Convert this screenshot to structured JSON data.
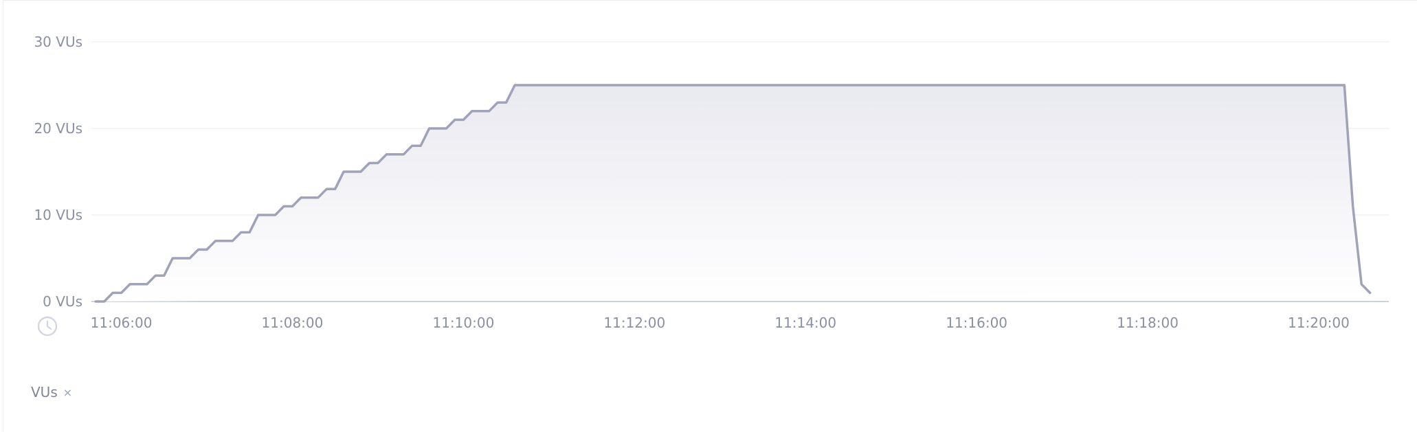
{
  "chart_data": {
    "type": "area",
    "ylim": [
      0,
      30
    ],
    "y_ticks": [
      {
        "value": 0,
        "label": "0 VUs"
      },
      {
        "value": 10,
        "label": "10 VUs"
      },
      {
        "value": 20,
        "label": "20 VUs"
      },
      {
        "value": 30,
        "label": "30 VUs"
      }
    ],
    "x_ticks": [
      "11:06:00",
      "11:08:00",
      "11:10:00",
      "11:12:00",
      "11:14:00",
      "11:16:00",
      "11:18:00",
      "11:20:00"
    ],
    "x_range_minutes": [
      -0.35,
      14.82
    ],
    "grid": true,
    "series": [
      {
        "name": "VUs",
        "color": "#9fa2b8",
        "x_minutes": [
          -0.3,
          -0.2,
          -0.1,
          0.0,
          0.1,
          0.2,
          0.3,
          0.4,
          0.5,
          0.6,
          0.7,
          0.8,
          0.9,
          1.0,
          1.1,
          1.2,
          1.3,
          1.4,
          1.5,
          1.6,
          1.7,
          1.8,
          1.9,
          2.0,
          2.1,
          2.2,
          2.3,
          2.4,
          2.5,
          2.6,
          2.7,
          2.8,
          2.9,
          3.0,
          3.1,
          3.2,
          3.3,
          3.4,
          3.5,
          3.6,
          3.7,
          3.8,
          3.9,
          4.0,
          4.1,
          4.2,
          4.3,
          4.4,
          4.5,
          4.6,
          4.7,
          4.8,
          4.9,
          5.0,
          5.1,
          5.2,
          5.3,
          5.4,
          5.5,
          5.6,
          5.7,
          5.8,
          5.9,
          6.0,
          6.1,
          6.2,
          6.3,
          6.4,
          6.5,
          6.6,
          6.7,
          6.8,
          6.9,
          7.0,
          7.1,
          7.2,
          7.3,
          7.4,
          7.5,
          7.6,
          7.7,
          7.8,
          7.9,
          8.0,
          8.1,
          8.2,
          8.3,
          8.4,
          8.5,
          8.6,
          8.7,
          8.8,
          8.9,
          9.0,
          9.1,
          9.2,
          9.3,
          9.4,
          9.5,
          9.6,
          9.7,
          9.8,
          9.9,
          10.0,
          10.1,
          10.2,
          10.3,
          10.4,
          10.5,
          10.6,
          10.7,
          10.8,
          10.9,
          11.0,
          11.1,
          11.2,
          11.3,
          11.4,
          11.5,
          11.6,
          11.7,
          11.8,
          11.9,
          12.0,
          12.1,
          12.2,
          12.3,
          12.4,
          12.5,
          12.6,
          12.7,
          12.8,
          12.9,
          13.0,
          13.1,
          13.2,
          13.3,
          13.4,
          13.5,
          13.6,
          13.7,
          13.8,
          13.9,
          14.0,
          14.1,
          14.2,
          14.3,
          14.4,
          14.5,
          14.6,
          14.7,
          14.8
        ],
        "values": [
          0,
          0,
          1,
          1,
          2,
          2,
          2,
          3,
          3,
          5,
          5,
          5,
          6,
          6,
          7,
          7,
          7,
          8,
          8,
          10,
          10,
          10,
          11,
          11,
          12,
          12,
          12,
          13,
          13,
          15,
          15,
          15,
          16,
          16,
          17,
          17,
          17,
          18,
          18,
          20,
          20,
          20,
          21,
          21,
          22,
          22,
          22,
          23,
          23,
          25,
          25,
          25,
          25,
          25,
          25,
          25,
          25,
          25,
          25,
          25,
          25,
          25,
          25,
          25,
          25,
          25,
          25,
          25,
          25,
          25,
          25,
          25,
          25,
          25,
          25,
          25,
          25,
          25,
          25,
          25,
          25,
          25,
          25,
          25,
          25,
          25,
          25,
          25,
          25,
          25,
          25,
          25,
          25,
          25,
          25,
          25,
          25,
          25,
          25,
          25,
          25,
          25,
          25,
          25,
          25,
          25,
          25,
          25,
          25,
          25,
          25,
          25,
          25,
          25,
          25,
          25,
          25,
          25,
          25,
          25,
          25,
          25,
          25,
          25,
          25,
          25,
          25,
          25,
          25,
          25,
          25,
          25,
          25,
          25,
          25,
          25,
          25,
          25,
          25,
          25,
          25,
          25,
          25,
          25,
          25,
          25,
          25,
          11,
          2,
          1
        ]
      }
    ]
  },
  "legend": {
    "label": "VUs",
    "close_glyph": "×"
  },
  "icons": {
    "time_axis": "clock-icon"
  }
}
